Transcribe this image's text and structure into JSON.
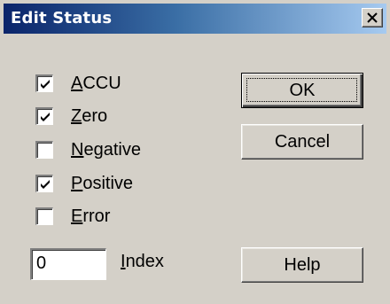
{
  "window": {
    "title": "Edit Status",
    "close_icon": "close-icon"
  },
  "flags": [
    {
      "mn": "A",
      "rest": "CCU",
      "checked": true
    },
    {
      "mn": "Z",
      "rest": "ero",
      "checked": true
    },
    {
      "mn": "N",
      "rest": "egative",
      "checked": false
    },
    {
      "mn": "P",
      "rest": "ositive",
      "checked": true
    },
    {
      "mn": "E",
      "rest": "rror",
      "checked": false
    }
  ],
  "index": {
    "value": "0",
    "label_mn": "I",
    "label_rest": "ndex"
  },
  "buttons": {
    "ok": "OK",
    "cancel": "Cancel",
    "help": "Help"
  },
  "colors": {
    "title_start": "#0a246a",
    "title_end": "#a6caf0",
    "face": "#d4d0c8"
  }
}
